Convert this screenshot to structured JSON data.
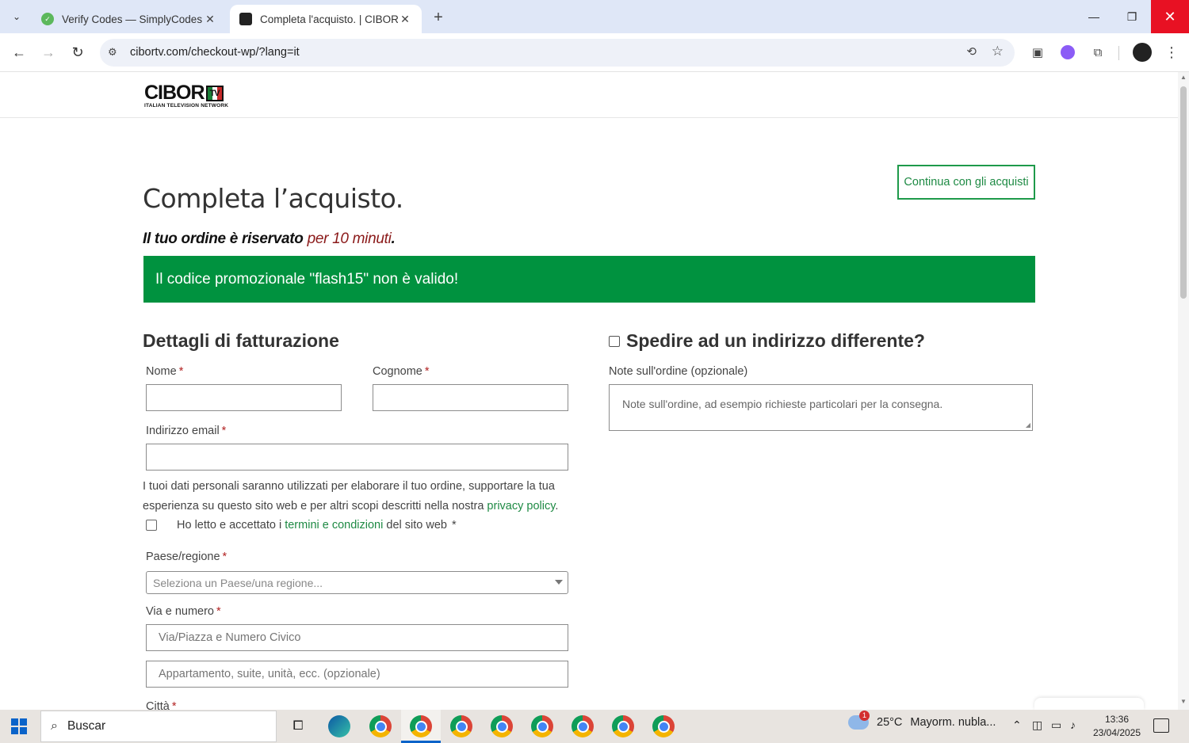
{
  "browser": {
    "tabs": [
      {
        "title": "Verify Codes — SimplyCodes",
        "active": false
      },
      {
        "title": "Completa l'acquisto. | CIBORTV",
        "active": true
      }
    ],
    "url": "cibortv.com/checkout-wp/?lang=it"
  },
  "site": {
    "logo_text": "CIBOR",
    "logo_badge": "TV",
    "logo_tagline": "ITALIAN TELEVISION NETWORK"
  },
  "checkout": {
    "title": "Completa l’acquisto.",
    "continue_label": "Continua con gli acquisti",
    "reserved_prefix": "Il tuo ordine è riservato ",
    "reserved_time": "per 10 minuti",
    "reserved_suffix": ".",
    "promo_message": "Il codice promozionale \"flash15\" non è valido!",
    "billing_title": "Dettagli di fatturazione",
    "ship_title": "Spedire ad un indirizzo differente?",
    "fields": {
      "first_name": "Nome",
      "last_name": "Cognome",
      "email": "Indirizzo email",
      "country": "Paese/regione",
      "country_placeholder": "Seleziona un Paese/una regione...",
      "street": "Via e numero",
      "street_placeholder": "Via/Piazza e Numero Civico",
      "apt_placeholder": "Appartamento, suite, unità, ecc. (opzionale)",
      "city": "Città",
      "required_mark": "*"
    },
    "notes_label": "Note sull'ordine (opzionale)",
    "notes_placeholder": "Note sull'ordine, ad esempio richieste particolari per la consegna.",
    "privacy_text": "I tuoi dati personali saranno utilizzati per elaborare il tuo ordine, supportare la tua esperienza su questo sito web e per altri scopi descritti nella nostra ",
    "privacy_link": "privacy policy",
    "privacy_end": ".",
    "terms_prefix": "Ho letto e accettato i ",
    "terms_link": "termini e condizioni",
    "terms_suffix": " del sito web",
    "terms_req": "*"
  },
  "taskbar": {
    "search_label": "Buscar",
    "weather_temp": "25°C",
    "weather_desc": "Mayorm. nubla...",
    "weather_badge": "1",
    "time": "13:36",
    "date": "23/04/2025"
  },
  "colors": {
    "accent_green": "#00923f",
    "link_green": "#1e8a44",
    "reserved_red": "#8b1a1a"
  }
}
